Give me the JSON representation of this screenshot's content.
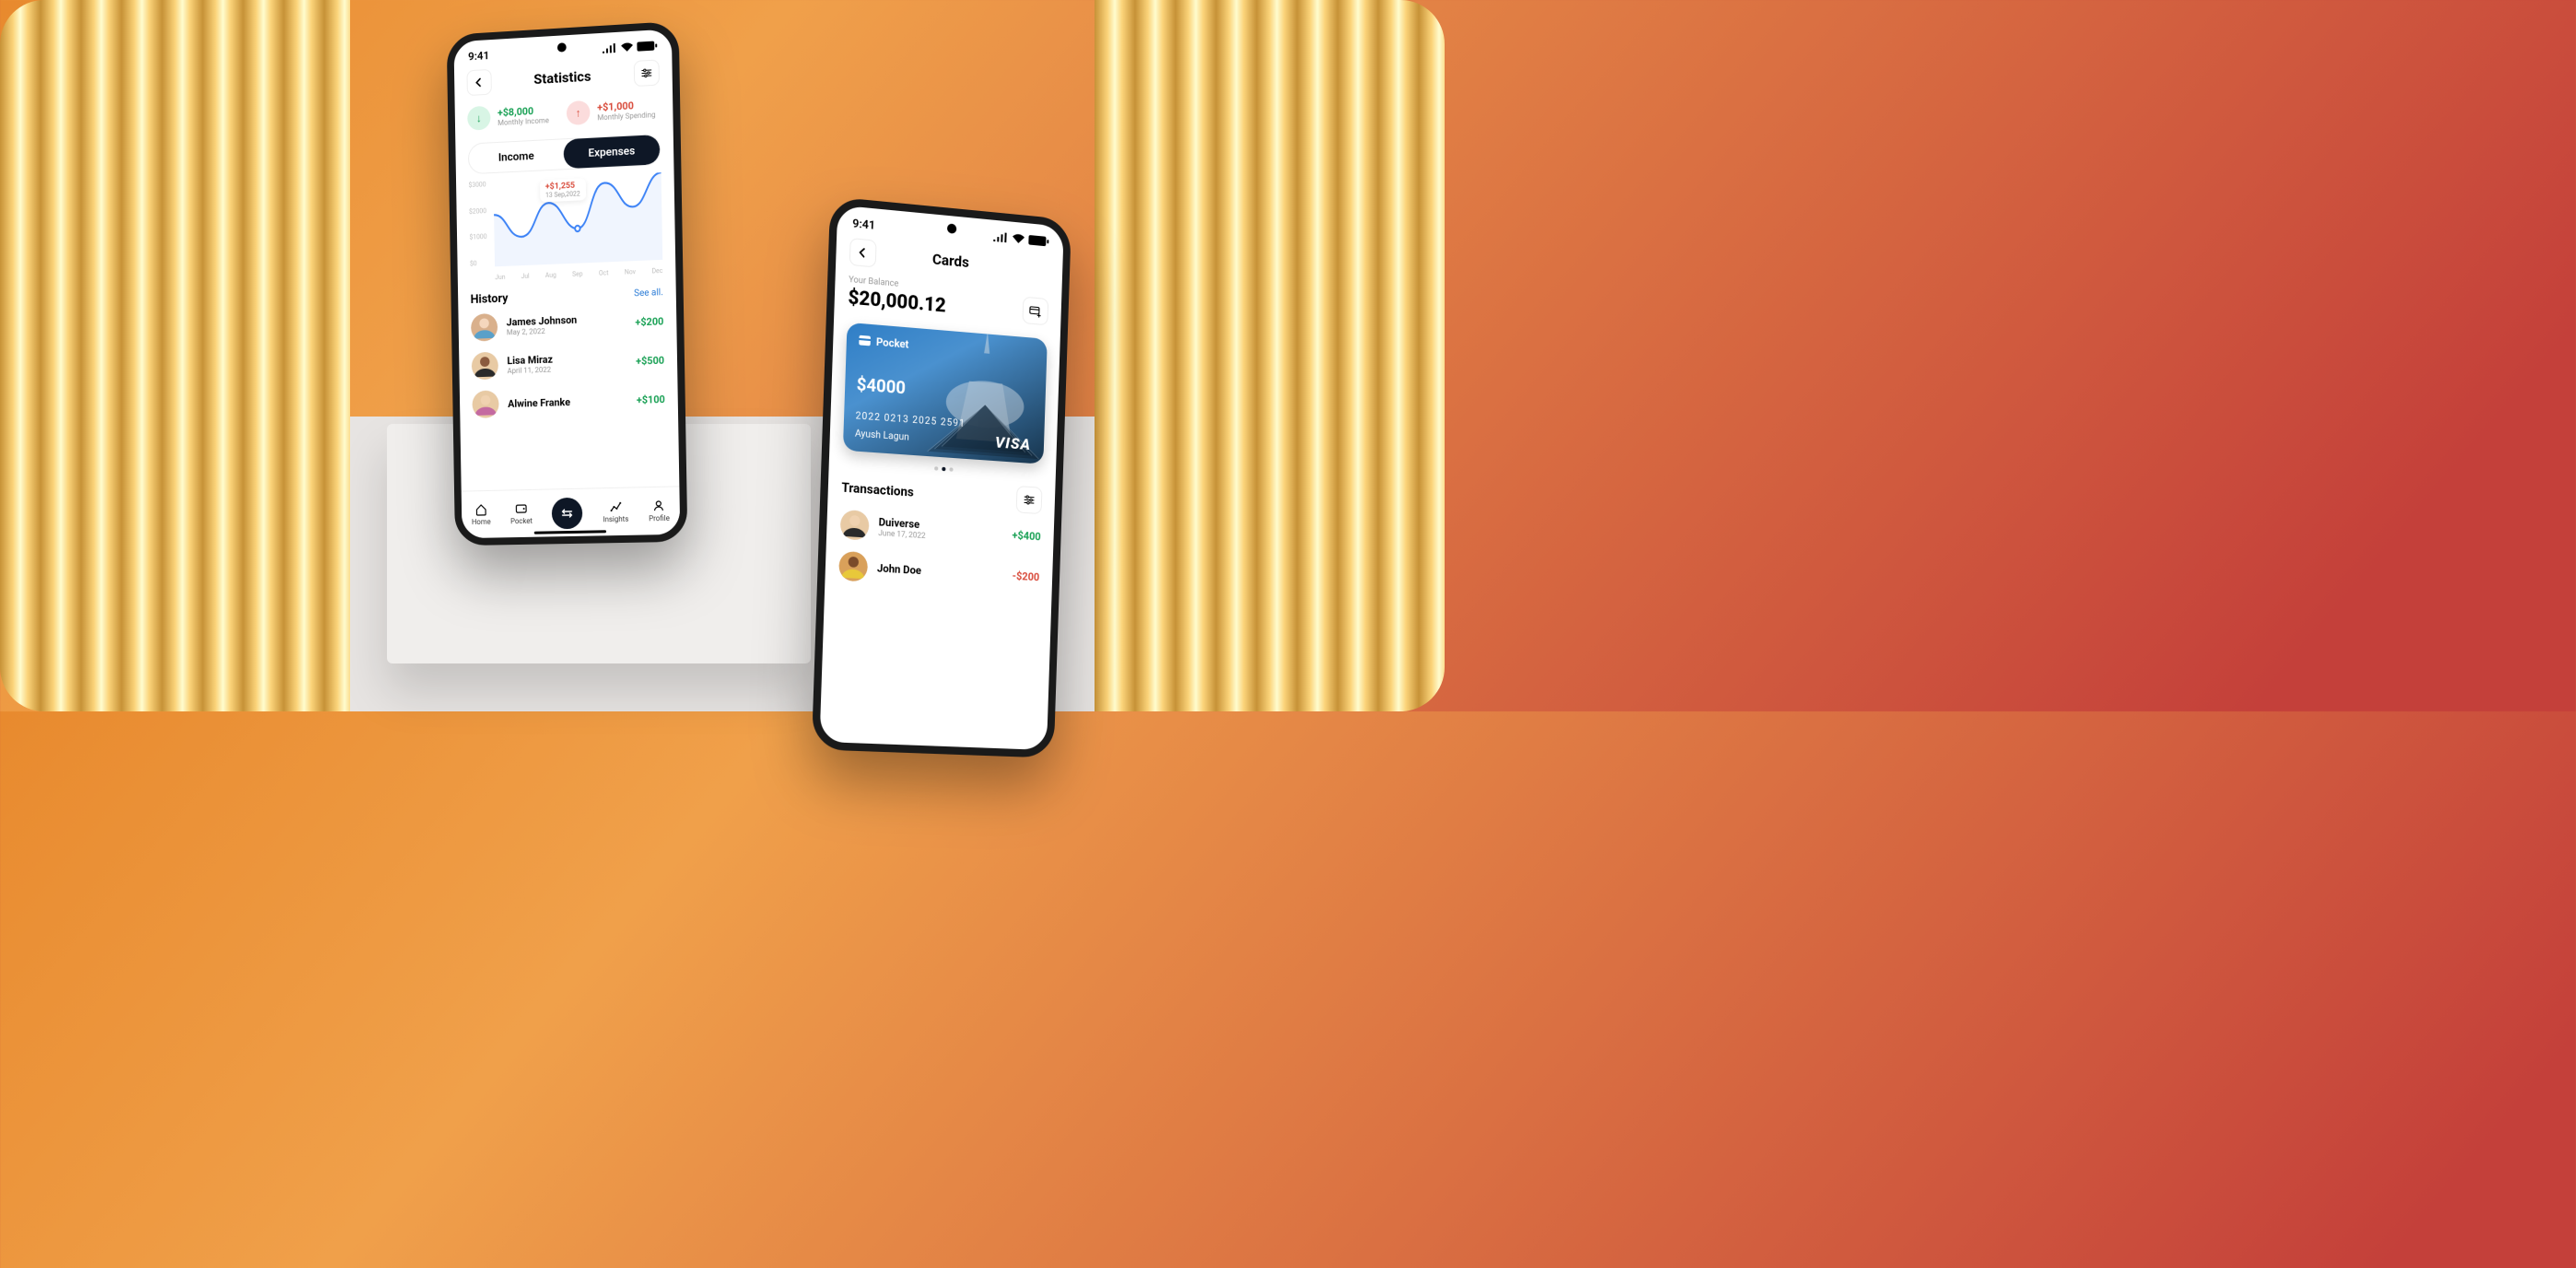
{
  "status_time": "9:41",
  "screen1": {
    "title": "Statistics",
    "income": {
      "amount": "+$8,000",
      "label": "Monthly  Income"
    },
    "spending": {
      "amount": "+$1,000",
      "label": "Monthly  Spending"
    },
    "seg_income": "Income",
    "seg_expenses": "Expenses",
    "chart_tip_value": "+$1,255",
    "chart_tip_date": "13 Sep,2022",
    "history_title": "History",
    "see_all": "See all.",
    "history": [
      {
        "name": "James Johnson",
        "date": "May 2, 2022",
        "amount": "+$200",
        "sign": "green"
      },
      {
        "name": "Lisa Miraz",
        "date": "April 11, 2022",
        "amount": "+$500",
        "sign": "green"
      },
      {
        "name": "Alwine Franke",
        "date": "",
        "amount": "+$100",
        "sign": "green"
      }
    ],
    "nav": {
      "home": "Home",
      "pocket": "Pocket",
      "insights": "Insights",
      "profile": "Profile"
    }
  },
  "screen2": {
    "title": "Cards",
    "balance_label": "Your Balance",
    "balance_value": "$20,000.12",
    "card": {
      "brand": "Pocket",
      "balance": "$4000",
      "number": "2022 0213 2025 2591",
      "holder": "Ayush Lagun",
      "network": "VISA"
    },
    "tx_title": "Transactions",
    "transactions": [
      {
        "name": "Duiverse",
        "date": "June 17, 2022",
        "amount": "+$400",
        "sign": "green"
      },
      {
        "name": "John Doe",
        "date": "",
        "amount": "-$200",
        "sign": "red"
      }
    ]
  },
  "chart_data": {
    "type": "line",
    "title": "",
    "xlabel": "",
    "ylabel": "",
    "ylim": [
      0,
      3000
    ],
    "y_ticks": [
      "$3000",
      "$2000",
      "$1000",
      "$0"
    ],
    "categories": [
      "Jun",
      "Jul",
      "Aug",
      "Sep",
      "Oct",
      "Nov",
      "Dec"
    ],
    "values": [
      1800,
      1100,
      2200,
      1255,
      2800,
      1900,
      3000
    ],
    "highlight": {
      "x": "Sep",
      "value": 1255,
      "label": "+$1,255",
      "date": "13 Sep,2022"
    }
  }
}
